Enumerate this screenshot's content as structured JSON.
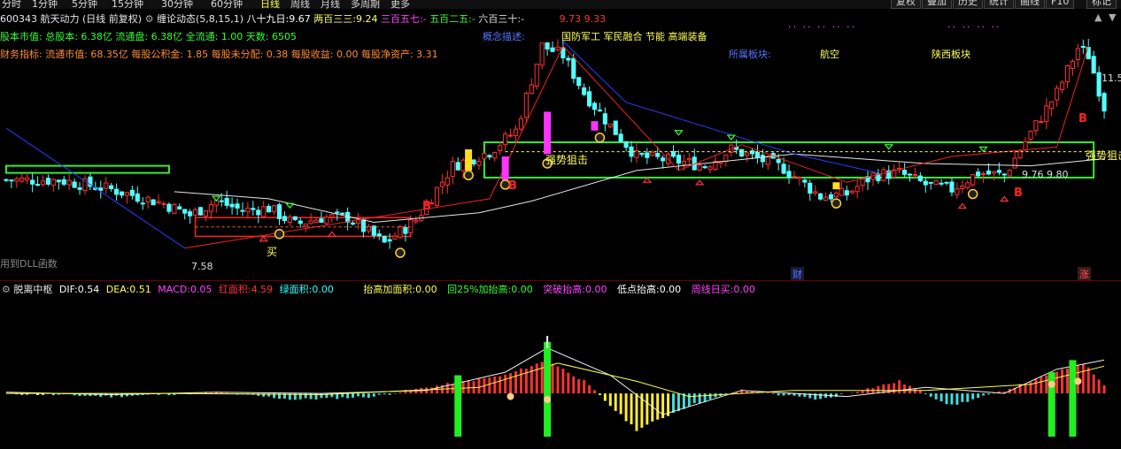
{
  "periods": [
    "分时",
    "1分钟",
    "5分钟",
    "15分钟",
    "30分钟",
    "60分钟",
    "日线",
    "周线",
    "月线",
    "多周期",
    "更多"
  ],
  "active_period": "日线",
  "right_buttons": [
    "复权",
    "叠加",
    "历史",
    "统计",
    "画线",
    "F10",
    "标记"
  ],
  "header": {
    "code": "600343",
    "name": "航天动力",
    "mode": "(日线 前复权)",
    "indicator": "缠论动态(5,8,15,1)",
    "v1_label": "八十九日:",
    "v1": "9.67",
    "v2_label": "两百三三:",
    "v2": "9.24",
    "v3_label": "三百五七:",
    "v3": "-",
    "v4_label": "五百二五:",
    "v4": "-",
    "v5_label": "六百三十:",
    "v5": "-",
    "v6": "9.73",
    "v7": "9.33"
  },
  "info1": {
    "text": "股本市值: 总股本: 6.38亿 流通盘: 6.38亿 全流通: 1.00 天数: 6505"
  },
  "info2": {
    "text": "财务指标: 流通市值: 68.35亿  每股公积金: 1.85  每股未分配: 0.38  每股收益: 0.00  每股净资产: 3.31"
  },
  "concept": {
    "label": "概念描述:",
    "value": "国防军工 军民融合 节能 高端装备"
  },
  "sector": {
    "label": "所属板块:",
    "a": "航空",
    "b": "陕西板块"
  },
  "annotations": {
    "strong1": "强势狙击",
    "strong2": "强势狙击",
    "buy": "买",
    "low": "7.58",
    "price_box": "9.76  9.80",
    "price_right": "11.5",
    "dll": "用到DLL函数",
    "cai": "财",
    "zhang": "涨",
    "b": "B"
  },
  "macd": {
    "title": "脱离中枢",
    "dif_label": "DIF:",
    "dif": "0.54",
    "dea_label": "DEA:",
    "dea": "0.51",
    "macd_label": "MACD:",
    "macd": "0.05",
    "red_label": "红面积:",
    "red": "4.59",
    "green_label": "绿面积:",
    "green": "0.00",
    "f1_label": "抬高加面积:",
    "f1": "0.00",
    "f2_label": "回25%加抬高:",
    "f2": "0.00",
    "f3_label": "突破抬高:",
    "f3": "0.00",
    "f4_label": "低点抬高:",
    "f4": "0.00",
    "f5_label": "周线日买:",
    "f5": "0.00"
  },
  "chart_data": {
    "type": "candlestick",
    "title": "",
    "ylim": [
      7.2,
      12.2
    ],
    "x_count": 210,
    "up_color": "#ff3030",
    "down_color": "#54ffff",
    "price_anchors": [
      [
        0,
        9.05
      ],
      [
        10,
        9.05
      ],
      [
        20,
        8.85
      ],
      [
        30,
        8.55
      ],
      [
        35,
        8.3
      ],
      [
        40,
        8.6
      ],
      [
        45,
        8.4
      ],
      [
        50,
        8.45
      ],
      [
        55,
        8.1
      ],
      [
        60,
        8.25
      ],
      [
        65,
        8.25
      ],
      [
        72,
        7.7
      ],
      [
        78,
        8.2
      ],
      [
        85,
        9.35
      ],
      [
        92,
        9.65
      ],
      [
        97,
        10.1
      ],
      [
        102,
        11.9
      ],
      [
        106,
        11.7
      ],
      [
        110,
        10.9
      ],
      [
        115,
        10.2
      ],
      [
        120,
        9.55
      ],
      [
        128,
        9.45
      ],
      [
        133,
        9.35
      ],
      [
        138,
        9.7
      ],
      [
        142,
        9.55
      ],
      [
        148,
        9.3
      ],
      [
        155,
        8.7
      ],
      [
        160,
        8.75
      ],
      [
        165,
        9.15
      ],
      [
        170,
        9.2
      ],
      [
        175,
        8.95
      ],
      [
        180,
        8.85
      ],
      [
        185,
        9.2
      ],
      [
        190,
        9.15
      ],
      [
        195,
        10.05
      ],
      [
        200,
        10.9
      ],
      [
        204,
        11.85
      ],
      [
        206,
        11.7
      ],
      [
        209,
        10.6
      ]
    ],
    "ma_white": [
      [
        32,
        8.8
      ],
      [
        50,
        8.65
      ],
      [
        70,
        8.15
      ],
      [
        90,
        8.35
      ],
      [
        100,
        8.6
      ],
      [
        120,
        9.25
      ],
      [
        150,
        9.6
      ],
      [
        175,
        9.4
      ],
      [
        195,
        9.35
      ],
      [
        209,
        9.5
      ]
    ],
    "ma_blue_a": [
      [
        0,
        10.15
      ],
      [
        34,
        7.6
      ]
    ],
    "ma_blue_b": [
      [
        106,
        12.0
      ],
      [
        118,
        10.7
      ],
      [
        150,
        9.6
      ],
      [
        166,
        9.2
      ]
    ],
    "ma_red": [
      [
        34,
        7.6
      ],
      [
        92,
        8.65
      ],
      [
        106,
        11.9
      ],
      [
        128,
        9.25
      ],
      [
        140,
        9.8
      ],
      [
        160,
        9.0
      ],
      [
        180,
        9.55
      ],
      [
        200,
        9.75
      ],
      [
        206,
        11.9
      ]
    ],
    "zones": [
      [
        0,
        9.2,
        31,
        9.35
      ],
      [
        91,
        9.1,
        207,
        9.85
      ],
      [
        36,
        7.85,
        77,
        8.25
      ]
    ],
    "macd_anchors": [
      [
        0,
        0.0
      ],
      [
        20,
        -0.05
      ],
      [
        40,
        0.02
      ],
      [
        55,
        -0.1
      ],
      [
        70,
        -0.05
      ],
      [
        80,
        0.1
      ],
      [
        95,
        0.3
      ],
      [
        103,
        0.55
      ],
      [
        110,
        0.2
      ],
      [
        120,
        -0.6
      ],
      [
        130,
        -0.2
      ],
      [
        140,
        0.05
      ],
      [
        155,
        -0.1
      ],
      [
        170,
        0.2
      ],
      [
        180,
        -0.2
      ],
      [
        190,
        0.05
      ],
      [
        200,
        0.35
      ],
      [
        205,
        0.5
      ],
      [
        209,
        0.15
      ]
    ],
    "dif": [
      [
        0,
        0.02
      ],
      [
        20,
        -0.02
      ],
      [
        40,
        0.02
      ],
      [
        60,
        0.0
      ],
      [
        80,
        0.05
      ],
      [
        95,
        0.35
      ],
      [
        103,
        0.75
      ],
      [
        115,
        0.3
      ],
      [
        125,
        -0.35
      ],
      [
        140,
        0.05
      ],
      [
        160,
        -0.05
      ],
      [
        175,
        0.1
      ],
      [
        190,
        0.0
      ],
      [
        200,
        0.4
      ],
      [
        209,
        0.55
      ]
    ],
    "dea": [
      [
        0,
        0.0
      ],
      [
        30,
        0.0
      ],
      [
        60,
        -0.02
      ],
      [
        90,
        0.1
      ],
      [
        105,
        0.5
      ],
      [
        120,
        0.2
      ],
      [
        130,
        -0.05
      ],
      [
        150,
        0.05
      ],
      [
        175,
        0.05
      ],
      [
        195,
        0.15
      ],
      [
        209,
        0.45
      ]
    ],
    "macd_ylim": [
      -0.8,
      0.95
    ]
  }
}
